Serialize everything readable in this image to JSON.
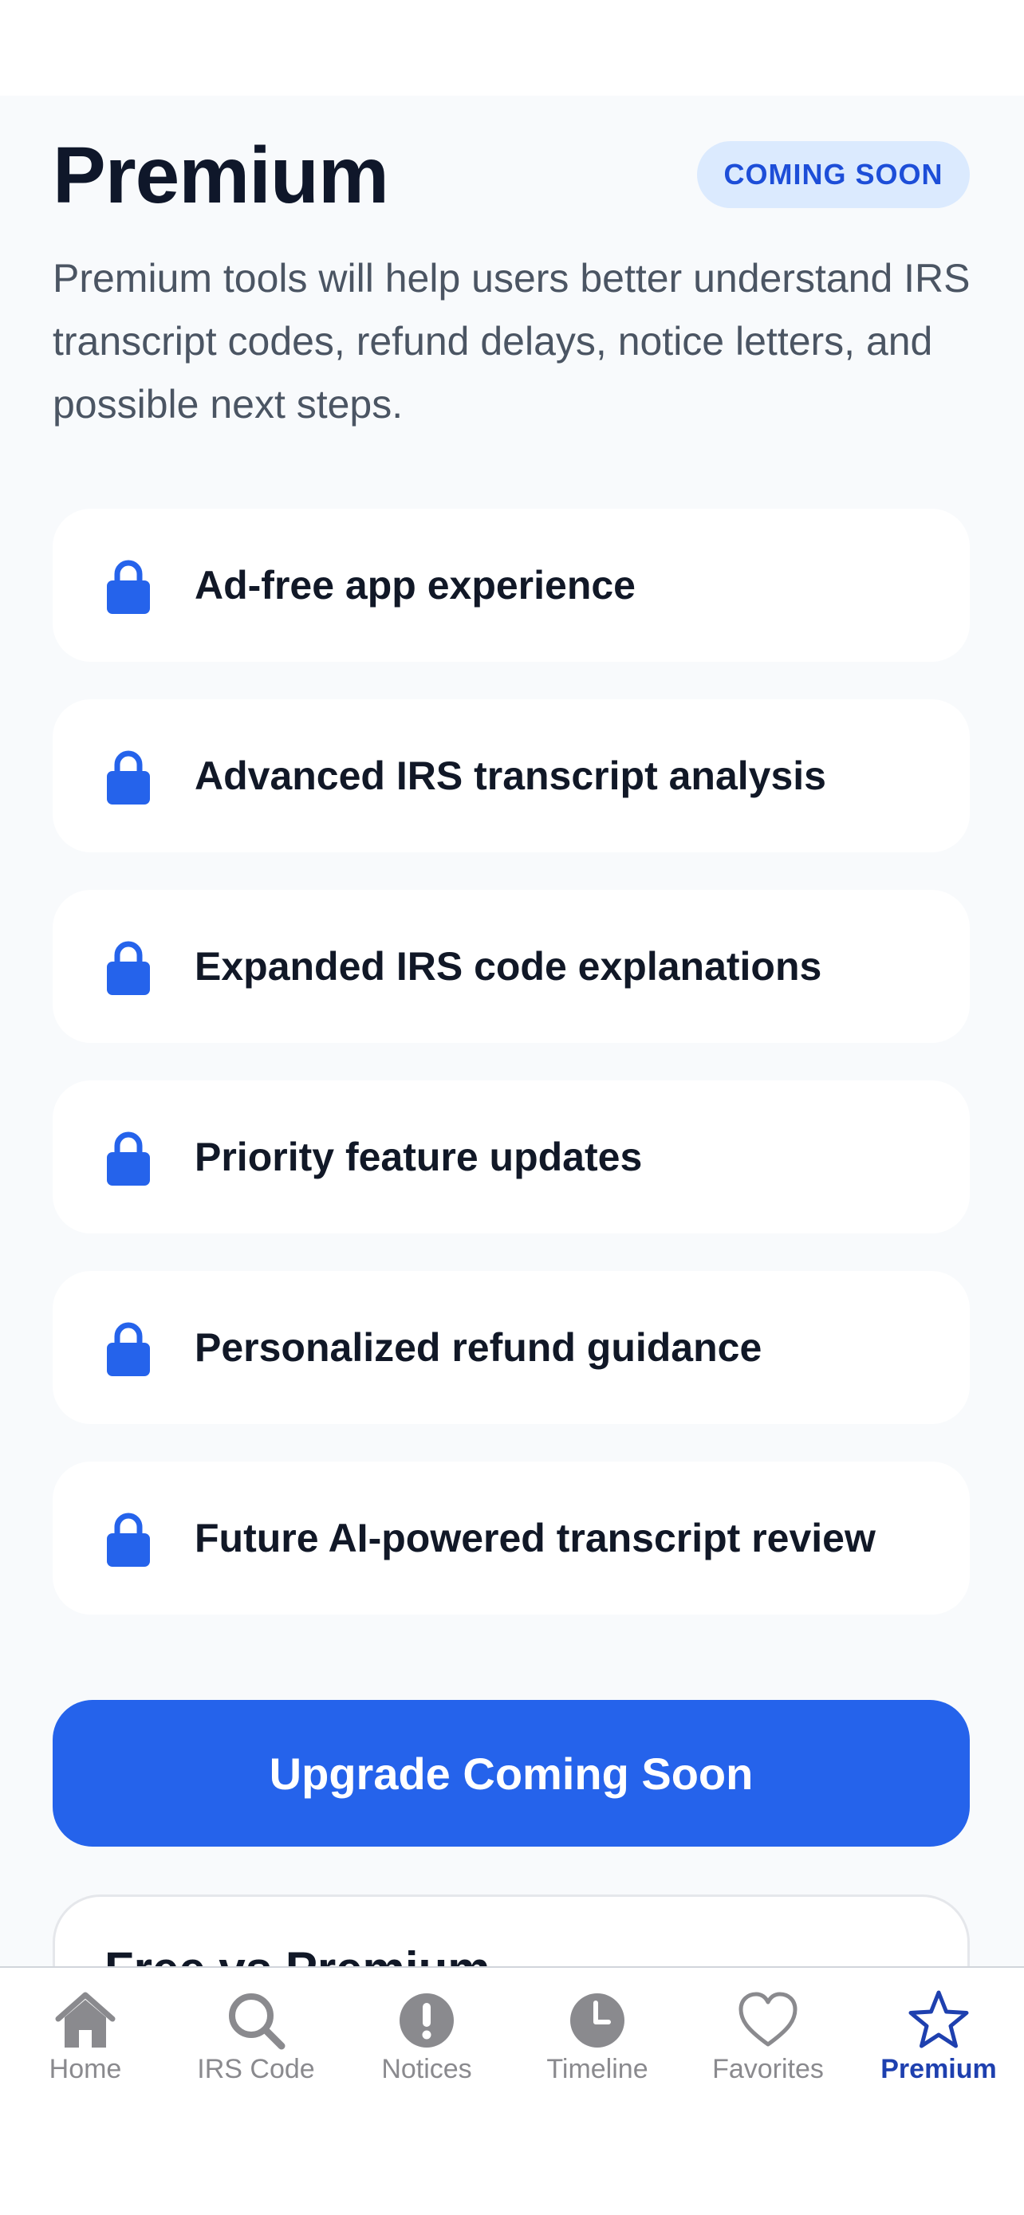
{
  "page": {
    "title": "Premium",
    "badge": "COMING SOON",
    "description": "Premium tools will help users better understand IRS transcript codes, refund delays, notice letters, and possible next steps."
  },
  "features": [
    {
      "label": "Ad-free app experience",
      "icon": "lock-icon"
    },
    {
      "label": "Advanced IRS transcript analysis",
      "icon": "lock-icon"
    },
    {
      "label": "Expanded IRS code explanations",
      "icon": "lock-icon"
    },
    {
      "label": "Priority feature updates",
      "icon": "lock-icon"
    },
    {
      "label": "Personalized refund guidance",
      "icon": "lock-icon"
    },
    {
      "label": "Future AI-powered transcript review",
      "icon": "lock-icon"
    }
  ],
  "upgrade_button": {
    "label": "Upgrade Coming Soon"
  },
  "comparison": {
    "title": "Free vs Premium"
  },
  "tab_bar": {
    "items": [
      {
        "label": "Home",
        "icon": "home-icon",
        "active": false
      },
      {
        "label": "IRS Code",
        "icon": "search-icon",
        "active": false
      },
      {
        "label": "Notices",
        "icon": "alert-icon",
        "active": false
      },
      {
        "label": "Timeline",
        "icon": "clock-icon",
        "active": false
      },
      {
        "label": "Favorites",
        "icon": "heart-icon",
        "active": false
      },
      {
        "label": "Premium",
        "icon": "star-icon",
        "active": true
      }
    ]
  },
  "colors": {
    "accent": "#2563eb",
    "badge_bg": "#dbeafe",
    "badge_text": "#1d4ed8",
    "page_bg": "#f8fafc",
    "tab_inactive": "#8a8a8e",
    "tab_active": "#1e40af"
  }
}
